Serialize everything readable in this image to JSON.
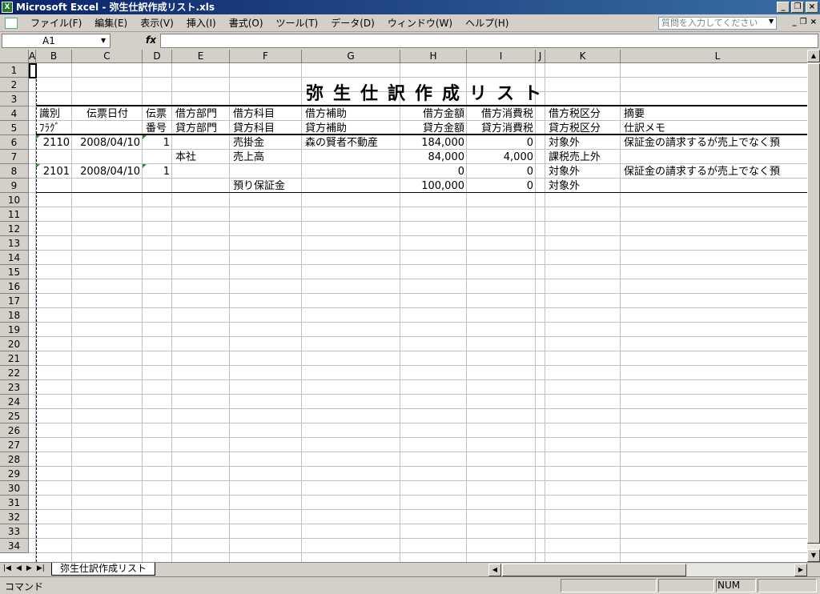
{
  "window": {
    "title": "Microsoft Excel - 弥生仕訳作成リスト.xls",
    "app_icon": "X"
  },
  "menu": {
    "items": [
      "ファイル(F)",
      "編集(E)",
      "表示(V)",
      "挿入(I)",
      "書式(O)",
      "ツール(T)",
      "データ(D)",
      "ウィンドウ(W)",
      "ヘルプ(H)"
    ],
    "ask_placeholder": "質問を入力してください"
  },
  "formula": {
    "name_box": "A1",
    "fx": "fx",
    "value": ""
  },
  "columns": [
    "A",
    "B",
    "C",
    "D",
    "E",
    "F",
    "G",
    "H",
    "I",
    "J",
    "K",
    "L"
  ],
  "rows": [
    "1",
    "2",
    "3",
    "4",
    "5",
    "6",
    "7",
    "8",
    "9",
    "10",
    "11",
    "12",
    "13",
    "14",
    "15",
    "16",
    "17",
    "18",
    "19",
    "20",
    "21",
    "22",
    "23",
    "24",
    "25",
    "26",
    "27",
    "28",
    "29",
    "30",
    "31",
    "32",
    "33",
    "34"
  ],
  "sheet": {
    "title": "弥生仕訳作成リスト",
    "header1": [
      "識別",
      "伝票日付",
      "伝票",
      "借方部門",
      "借方科目",
      "借方補助",
      "借方金額",
      "借方消費税",
      "借方税区分",
      "摘要"
    ],
    "header2": [
      "ﾌﾗｸﾞ",
      "",
      "番号",
      "貸方部門",
      "貸方科目",
      "貸方補助",
      "貸方金額",
      "貸方消費税",
      "貸方税区分",
      "仕訳メモ"
    ],
    "rows": [
      [
        "2110",
        "2008/04/10",
        "1",
        "",
        "売掛金",
        "森の賢者不動産",
        "184,000",
        "0",
        "対象外",
        "保証金の請求するが売上でなく預"
      ],
      [
        "",
        "",
        "",
        "本社",
        "売上高",
        "",
        "84,000",
        "4,000",
        "課税売上外",
        ""
      ],
      [
        "2101",
        "2008/04/10",
        "1",
        "",
        "",
        "",
        "0",
        "0",
        "対象外",
        "保証金の請求するが売上でなく預"
      ],
      [
        "",
        "",
        "",
        "",
        "預り保証金",
        "",
        "100,000",
        "0",
        "対象外",
        ""
      ]
    ]
  },
  "tabs": {
    "active": "弥生仕訳作成リスト"
  },
  "status": {
    "mode": "コマンド",
    "num": "NUM"
  }
}
